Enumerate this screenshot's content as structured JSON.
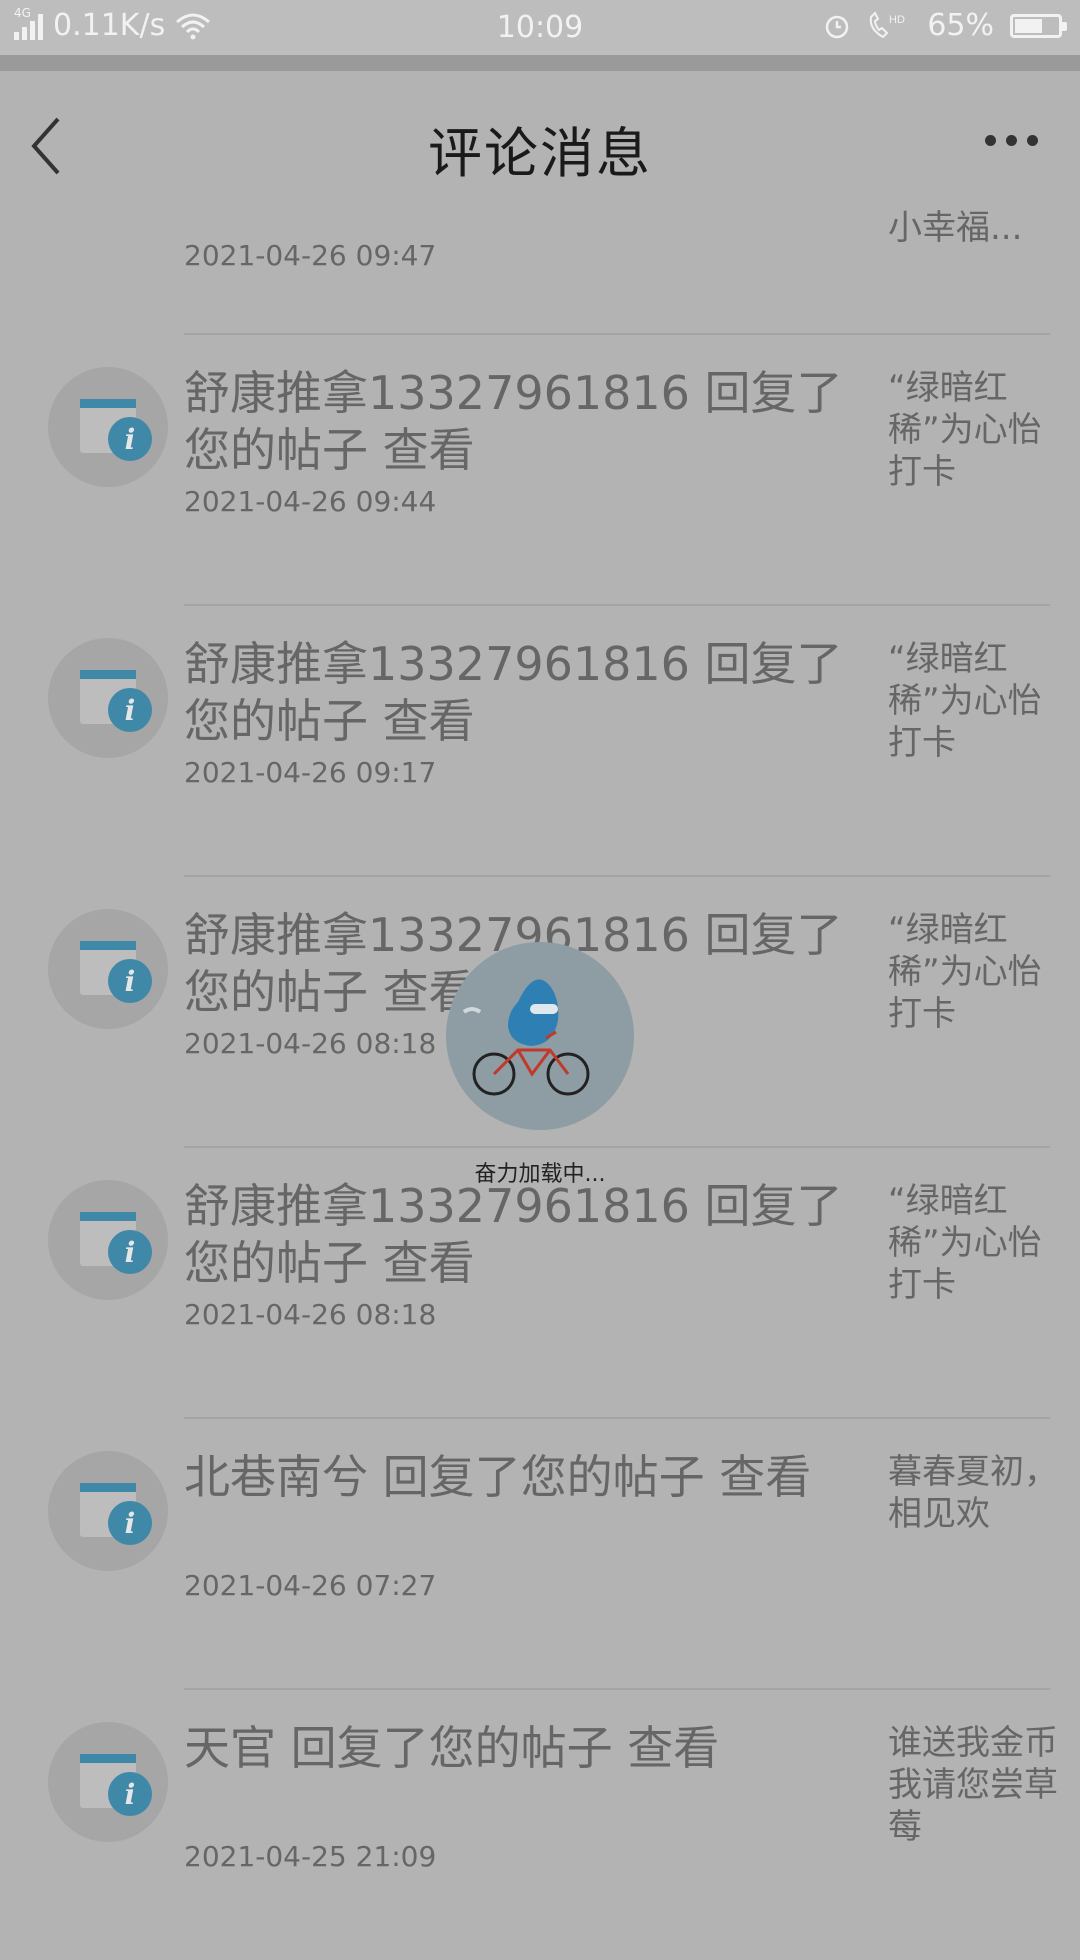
{
  "status_bar": {
    "network_tag": "4G",
    "speed": "0.11K/s",
    "time": "10:09",
    "battery": "65%",
    "battery_level": 0.65
  },
  "header": {
    "title": "评论消息"
  },
  "partial_item": {
    "ref": "小幸福...",
    "time": "2021-04-26 09:47"
  },
  "items": [
    {
      "message": "舒康推拿13327961816 回复了您的帖子 查看",
      "time": "2021-04-26 09:44",
      "ref": "“绿暗红稀”为心怡打卡"
    },
    {
      "message": "舒康推拿13327961816 回复了您的帖子 查看",
      "time": "2021-04-26 09:17",
      "ref": "“绿暗红稀”为心怡打卡"
    },
    {
      "message": "舒康推拿13327961816 回复了您的帖子 查看",
      "time": "2021-04-26 08:18",
      "ref": "“绿暗红稀”为心怡打卡"
    },
    {
      "message": "舒康推拿13327961816 回复了您的帖子 查看",
      "time": "2021-04-26 08:18",
      "ref": "“绿暗红稀”为心怡打卡"
    },
    {
      "message": "北巷南兮 回复了您的帖子 查看",
      "time": "2021-04-26 07:27",
      "ref": "暮春夏初，相见欢"
    },
    {
      "message": "天官 回复了您的帖子 查看",
      "time": "2021-04-25 21:09",
      "ref": "谁送我金币我请您尝草莓"
    }
  ],
  "loader": {
    "text": "奋力加载中..."
  },
  "colors": {
    "icon_accent": "#3f88a8",
    "loader_bg": "#8e9ca4"
  }
}
